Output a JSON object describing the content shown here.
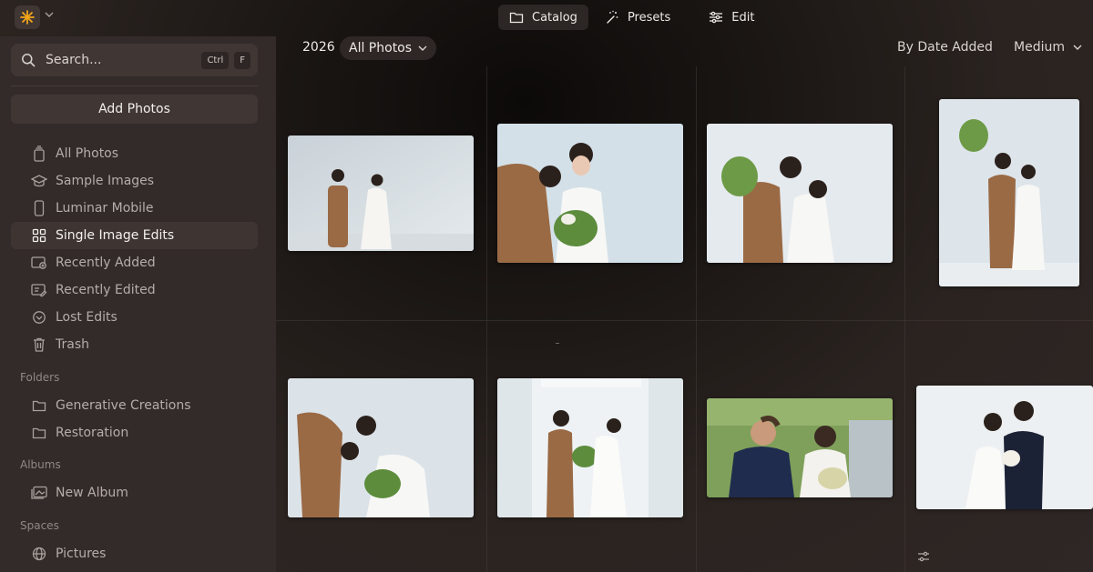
{
  "header": {
    "tabs": [
      {
        "label": "Catalog",
        "icon": "folder-icon",
        "active": true
      },
      {
        "label": "Presets",
        "icon": "magic-wand-icon",
        "active": false
      },
      {
        "label": "Edit",
        "icon": "sliders-icon",
        "active": false
      }
    ]
  },
  "sidebar": {
    "search": {
      "placeholder": "Search...",
      "shortcut": [
        "Ctrl",
        "F"
      ]
    },
    "add_photos_label": "Add Photos",
    "library": [
      {
        "label": "All Photos",
        "icon": "photo-stack-icon",
        "active": false
      },
      {
        "label": "Sample Images",
        "icon": "graduation-cap-icon",
        "active": false
      },
      {
        "label": "Luminar Mobile",
        "icon": "phone-icon",
        "active": false
      },
      {
        "label": "Single Image Edits",
        "icon": "grid-icon",
        "active": true
      },
      {
        "label": "Recently Added",
        "icon": "recently-added-icon",
        "active": false
      },
      {
        "label": "Recently Edited",
        "icon": "recently-edited-icon",
        "active": false
      },
      {
        "label": "Lost Edits",
        "icon": "lost-edits-icon",
        "active": false
      },
      {
        "label": "Trash",
        "icon": "trash-icon",
        "active": false
      }
    ],
    "folders_label": "Folders",
    "folders": [
      {
        "label": "Generative Creations",
        "icon": "folder-icon"
      },
      {
        "label": "Restoration",
        "icon": "folder-icon"
      }
    ],
    "albums_label": "Albums",
    "albums": [
      {
        "label": "New Album",
        "icon": "album-icon"
      }
    ],
    "spaces_label": "Spaces",
    "spaces": [
      {
        "label": "Pictures",
        "icon": "globe-icon"
      }
    ]
  },
  "toolbar": {
    "year": "2026",
    "filter_label": "All Photos",
    "sort_label": "By Date Added",
    "size_label": "Medium"
  },
  "colors": {
    "accent": "#f2a51a",
    "sidebar_bg": "#332b29",
    "active_item_bg": "#3e3533"
  }
}
